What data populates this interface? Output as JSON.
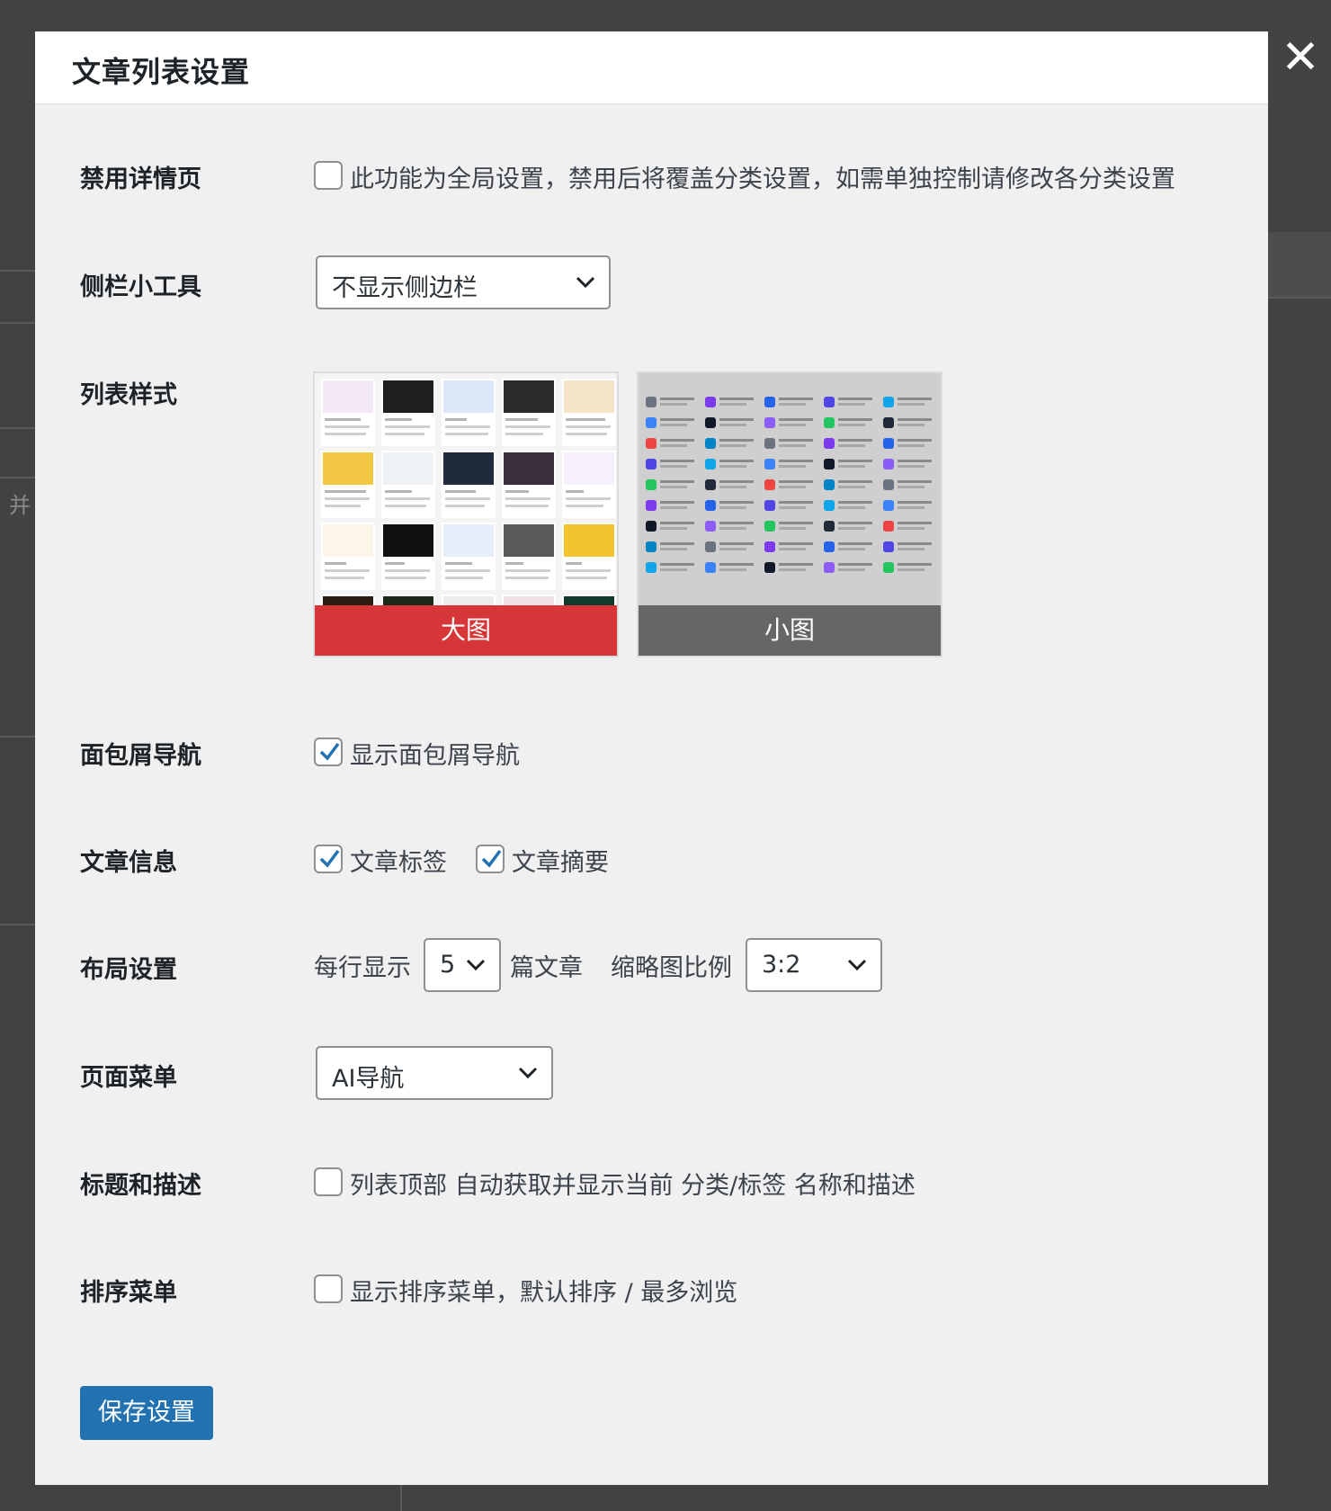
{
  "modal": {
    "title": "文章列表设置",
    "close_label": "✕"
  },
  "background": {
    "hint_text": "并"
  },
  "rows": {
    "disable_detail": {
      "label": "禁用详情页",
      "checked": false,
      "option_text": "此功能为全局设置，禁用后将覆盖分类设置，如需单独控制请修改各分类设置"
    },
    "sidebar": {
      "label": "侧栏小工具",
      "selected": "不显示侧边栏"
    },
    "list_style": {
      "label": "列表样式",
      "options": [
        {
          "label": "大图",
          "selected": true
        },
        {
          "label": "小图",
          "selected": false
        }
      ]
    },
    "breadcrumb": {
      "label": "面包屑导航",
      "checked": true,
      "option_text": "显示面包屑导航"
    },
    "post_info": {
      "label": "文章信息",
      "options": [
        {
          "text": "文章标签",
          "checked": true
        },
        {
          "text": "文章摘要",
          "checked": true
        }
      ]
    },
    "layout": {
      "label": "布局设置",
      "prefix": "每行显示",
      "per_row": "5",
      "suffix": "篇文章",
      "ratio_label": "缩略图比例",
      "ratio": "3:2"
    },
    "page_menu": {
      "label": "页面菜单",
      "selected": "AI导航"
    },
    "title_desc": {
      "label": "标题和描述",
      "checked": false,
      "option_text": "列表顶部 自动获取并显示当前 分类/标签 名称和描述"
    },
    "sort_menu": {
      "label": "排序菜单",
      "checked": false,
      "option_text": "显示排序菜单，默认排序 / 最多浏览"
    }
  },
  "save_button": "保存设置",
  "colors": {
    "primary": "#2271b1",
    "selected_style": "#d63638",
    "unselected_style": "#666666",
    "checkmark": "#2271b1"
  }
}
